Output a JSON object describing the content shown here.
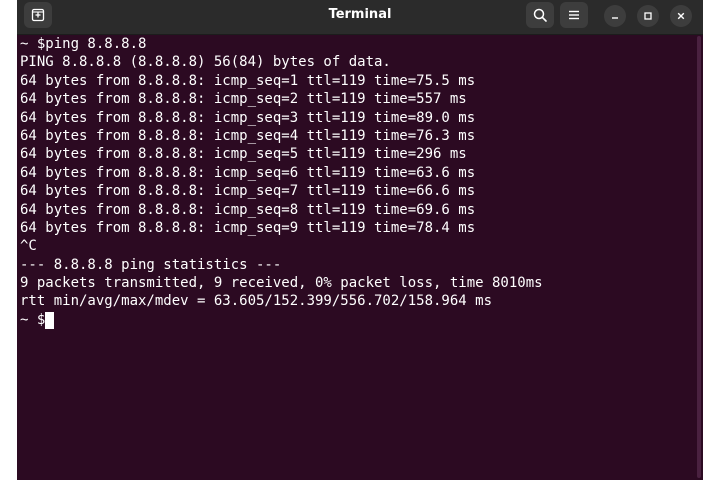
{
  "window": {
    "title": "Terminal"
  },
  "icons": {
    "new_tab": "new-tab-icon",
    "search": "search-icon",
    "menu": "hamburger-menu-icon",
    "minimize": "minimize-icon",
    "maximize": "maximize-icon",
    "close": "close-icon"
  },
  "colors": {
    "terminal_bg": "#2c0a22",
    "titlebar_bg": "#2b2b2b",
    "text": "#ffffff"
  },
  "terminal": {
    "lines": [
      "~ $ping 8.8.8.8",
      "PING 8.8.8.8 (8.8.8.8) 56(84) bytes of data.",
      "64 bytes from 8.8.8.8: icmp_seq=1 ttl=119 time=75.5 ms",
      "64 bytes from 8.8.8.8: icmp_seq=2 ttl=119 time=557 ms",
      "64 bytes from 8.8.8.8: icmp_seq=3 ttl=119 time=89.0 ms",
      "64 bytes from 8.8.8.8: icmp_seq=4 ttl=119 time=76.3 ms",
      "64 bytes from 8.8.8.8: icmp_seq=5 ttl=119 time=296 ms",
      "64 bytes from 8.8.8.8: icmp_seq=6 ttl=119 time=63.6 ms",
      "64 bytes from 8.8.8.8: icmp_seq=7 ttl=119 time=66.6 ms",
      "64 bytes from 8.8.8.8: icmp_seq=8 ttl=119 time=69.6 ms",
      "64 bytes from 8.8.8.8: icmp_seq=9 ttl=119 time=78.4 ms",
      "^C",
      "--- 8.8.8.8 ping statistics ---",
      "9 packets transmitted, 9 received, 0% packet loss, time 8010ms",
      "rtt min/avg/max/mdev = 63.605/152.399/556.702/158.964 ms"
    ],
    "prompt": "~ $"
  }
}
